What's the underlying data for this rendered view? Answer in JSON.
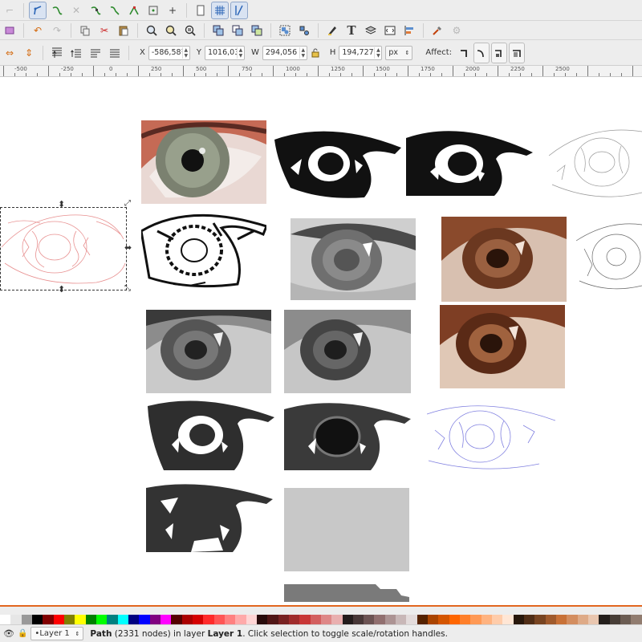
{
  "toolbar": {
    "snap_icons": [
      "snap-toggle-icon",
      "snap-path-icon",
      "snap-node-icon",
      "snap-midpoint-icon",
      "snap-smooth-icon",
      "snap-cusp-icon",
      "snap-center-icon",
      "snap-rotation-icon",
      "snap-page-icon",
      "snap-grid-icon",
      "snap-guide-icon"
    ],
    "command_icons": [
      "new-doc-icon",
      "undo-icon",
      "redo-icon",
      "copy-icon",
      "cut-icon",
      "paste-icon",
      "zoom-selection-icon",
      "zoom-drawing-icon",
      "zoom-page-icon",
      "duplicate-icon",
      "clone-icon",
      "unlink-clone-icon",
      "group-icon",
      "ungroup-icon",
      "fill-stroke-icon",
      "text-icon",
      "layers-icon",
      "xml-editor-icon",
      "align-icon",
      "preferences-icon",
      "document-properties-icon"
    ]
  },
  "transform": {
    "x_label": "X",
    "x_value": "-586,58¹",
    "y_label": "Y",
    "y_value": "1016,03",
    "w_label": "W",
    "w_value": "294,056",
    "h_label": "H",
    "h_value": "194,727",
    "unit": "px",
    "affect_label": "Affect:"
  },
  "ruler": {
    "labels": [
      "-500",
      "-250",
      "0",
      "250",
      "500",
      "750",
      "1000",
      "1250",
      "1500",
      "1750",
      "2000",
      "2250",
      "2500"
    ]
  },
  "palette": {
    "colors": [
      "#ffffff",
      "#e6e6e6",
      "#999999",
      "#000000",
      "#800000",
      "#ff0000",
      "#808000",
      "#ffff00",
      "#008000",
      "#00ff00",
      "#008080",
      "#00ffff",
      "#000080",
      "#0000ff",
      "#800080",
      "#ff00ff",
      "#550000",
      "#aa0000",
      "#d40000",
      "#ff2a2a",
      "#ff5555",
      "#ff8080",
      "#ffaaaa",
      "#ffd5d5",
      "#280b0b",
      "#501616",
      "#782121",
      "#a02c2c",
      "#c83737",
      "#d35f5f",
      "#de8787",
      "#e9afaf",
      "#241c1c",
      "#483737",
      "#6c5353",
      "#916f6f",
      "#ac9393",
      "#c8b7b7",
      "#e3dbdb",
      "#552200",
      "#aa4400",
      "#d45500",
      "#ff6600",
      "#ff7f2a",
      "#ff9955",
      "#ffb380",
      "#ffccaa",
      "#ffe6d5",
      "#28170b",
      "#502d16",
      "#784421",
      "#a05a2c",
      "#c87137",
      "#d38d5f",
      "#deaa87",
      "#e9c6af",
      "#241f1c",
      "#483e37",
      "#6c5d53",
      "#917c6f"
    ]
  },
  "status": {
    "layer_name": "•Layer 1",
    "msg_bold_1": "Path",
    "msg_part_1": " (2331 nodes) in layer ",
    "msg_bold_2": "Layer 1",
    "msg_part_2": ". Click selection to toggle scale/rotation handles."
  }
}
